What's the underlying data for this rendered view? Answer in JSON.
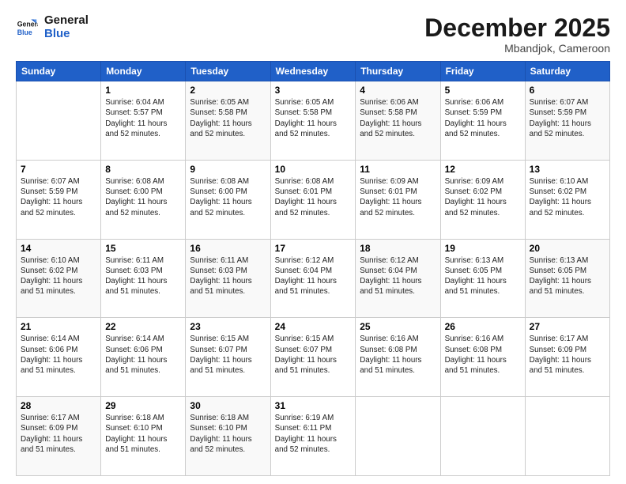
{
  "header": {
    "logo_line1": "General",
    "logo_line2": "Blue",
    "month_title": "December 2025",
    "location": "Mbandjok, Cameroon"
  },
  "days_of_week": [
    "Sunday",
    "Monday",
    "Tuesday",
    "Wednesday",
    "Thursday",
    "Friday",
    "Saturday"
  ],
  "weeks": [
    [
      {
        "day": "",
        "sunrise": "",
        "sunset": "",
        "daylight": ""
      },
      {
        "day": "1",
        "sunrise": "Sunrise: 6:04 AM",
        "sunset": "Sunset: 5:57 PM",
        "daylight": "Daylight: 11 hours and 52 minutes."
      },
      {
        "day": "2",
        "sunrise": "Sunrise: 6:05 AM",
        "sunset": "Sunset: 5:58 PM",
        "daylight": "Daylight: 11 hours and 52 minutes."
      },
      {
        "day": "3",
        "sunrise": "Sunrise: 6:05 AM",
        "sunset": "Sunset: 5:58 PM",
        "daylight": "Daylight: 11 hours and 52 minutes."
      },
      {
        "day": "4",
        "sunrise": "Sunrise: 6:06 AM",
        "sunset": "Sunset: 5:58 PM",
        "daylight": "Daylight: 11 hours and 52 minutes."
      },
      {
        "day": "5",
        "sunrise": "Sunrise: 6:06 AM",
        "sunset": "Sunset: 5:59 PM",
        "daylight": "Daylight: 11 hours and 52 minutes."
      },
      {
        "day": "6",
        "sunrise": "Sunrise: 6:07 AM",
        "sunset": "Sunset: 5:59 PM",
        "daylight": "Daylight: 11 hours and 52 minutes."
      }
    ],
    [
      {
        "day": "7",
        "sunrise": "Sunrise: 6:07 AM",
        "sunset": "Sunset: 5:59 PM",
        "daylight": "Daylight: 11 hours and 52 minutes."
      },
      {
        "day": "8",
        "sunrise": "Sunrise: 6:08 AM",
        "sunset": "Sunset: 6:00 PM",
        "daylight": "Daylight: 11 hours and 52 minutes."
      },
      {
        "day": "9",
        "sunrise": "Sunrise: 6:08 AM",
        "sunset": "Sunset: 6:00 PM",
        "daylight": "Daylight: 11 hours and 52 minutes."
      },
      {
        "day": "10",
        "sunrise": "Sunrise: 6:08 AM",
        "sunset": "Sunset: 6:01 PM",
        "daylight": "Daylight: 11 hours and 52 minutes."
      },
      {
        "day": "11",
        "sunrise": "Sunrise: 6:09 AM",
        "sunset": "Sunset: 6:01 PM",
        "daylight": "Daylight: 11 hours and 52 minutes."
      },
      {
        "day": "12",
        "sunrise": "Sunrise: 6:09 AM",
        "sunset": "Sunset: 6:02 PM",
        "daylight": "Daylight: 11 hours and 52 minutes."
      },
      {
        "day": "13",
        "sunrise": "Sunrise: 6:10 AM",
        "sunset": "Sunset: 6:02 PM",
        "daylight": "Daylight: 11 hours and 52 minutes."
      }
    ],
    [
      {
        "day": "14",
        "sunrise": "Sunrise: 6:10 AM",
        "sunset": "Sunset: 6:02 PM",
        "daylight": "Daylight: 11 hours and 51 minutes."
      },
      {
        "day": "15",
        "sunrise": "Sunrise: 6:11 AM",
        "sunset": "Sunset: 6:03 PM",
        "daylight": "Daylight: 11 hours and 51 minutes."
      },
      {
        "day": "16",
        "sunrise": "Sunrise: 6:11 AM",
        "sunset": "Sunset: 6:03 PM",
        "daylight": "Daylight: 11 hours and 51 minutes."
      },
      {
        "day": "17",
        "sunrise": "Sunrise: 6:12 AM",
        "sunset": "Sunset: 6:04 PM",
        "daylight": "Daylight: 11 hours and 51 minutes."
      },
      {
        "day": "18",
        "sunrise": "Sunrise: 6:12 AM",
        "sunset": "Sunset: 6:04 PM",
        "daylight": "Daylight: 11 hours and 51 minutes."
      },
      {
        "day": "19",
        "sunrise": "Sunrise: 6:13 AM",
        "sunset": "Sunset: 6:05 PM",
        "daylight": "Daylight: 11 hours and 51 minutes."
      },
      {
        "day": "20",
        "sunrise": "Sunrise: 6:13 AM",
        "sunset": "Sunset: 6:05 PM",
        "daylight": "Daylight: 11 hours and 51 minutes."
      }
    ],
    [
      {
        "day": "21",
        "sunrise": "Sunrise: 6:14 AM",
        "sunset": "Sunset: 6:06 PM",
        "daylight": "Daylight: 11 hours and 51 minutes."
      },
      {
        "day": "22",
        "sunrise": "Sunrise: 6:14 AM",
        "sunset": "Sunset: 6:06 PM",
        "daylight": "Daylight: 11 hours and 51 minutes."
      },
      {
        "day": "23",
        "sunrise": "Sunrise: 6:15 AM",
        "sunset": "Sunset: 6:07 PM",
        "daylight": "Daylight: 11 hours and 51 minutes."
      },
      {
        "day": "24",
        "sunrise": "Sunrise: 6:15 AM",
        "sunset": "Sunset: 6:07 PM",
        "daylight": "Daylight: 11 hours and 51 minutes."
      },
      {
        "day": "25",
        "sunrise": "Sunrise: 6:16 AM",
        "sunset": "Sunset: 6:08 PM",
        "daylight": "Daylight: 11 hours and 51 minutes."
      },
      {
        "day": "26",
        "sunrise": "Sunrise: 6:16 AM",
        "sunset": "Sunset: 6:08 PM",
        "daylight": "Daylight: 11 hours and 51 minutes."
      },
      {
        "day": "27",
        "sunrise": "Sunrise: 6:17 AM",
        "sunset": "Sunset: 6:09 PM",
        "daylight": "Daylight: 11 hours and 51 minutes."
      }
    ],
    [
      {
        "day": "28",
        "sunrise": "Sunrise: 6:17 AM",
        "sunset": "Sunset: 6:09 PM",
        "daylight": "Daylight: 11 hours and 51 minutes."
      },
      {
        "day": "29",
        "sunrise": "Sunrise: 6:18 AM",
        "sunset": "Sunset: 6:10 PM",
        "daylight": "Daylight: 11 hours and 51 minutes."
      },
      {
        "day": "30",
        "sunrise": "Sunrise: 6:18 AM",
        "sunset": "Sunset: 6:10 PM",
        "daylight": "Daylight: 11 hours and 52 minutes."
      },
      {
        "day": "31",
        "sunrise": "Sunrise: 6:19 AM",
        "sunset": "Sunset: 6:11 PM",
        "daylight": "Daylight: 11 hours and 52 minutes."
      },
      {
        "day": "",
        "sunrise": "",
        "sunset": "",
        "daylight": ""
      },
      {
        "day": "",
        "sunrise": "",
        "sunset": "",
        "daylight": ""
      },
      {
        "day": "",
        "sunrise": "",
        "sunset": "",
        "daylight": ""
      }
    ]
  ]
}
